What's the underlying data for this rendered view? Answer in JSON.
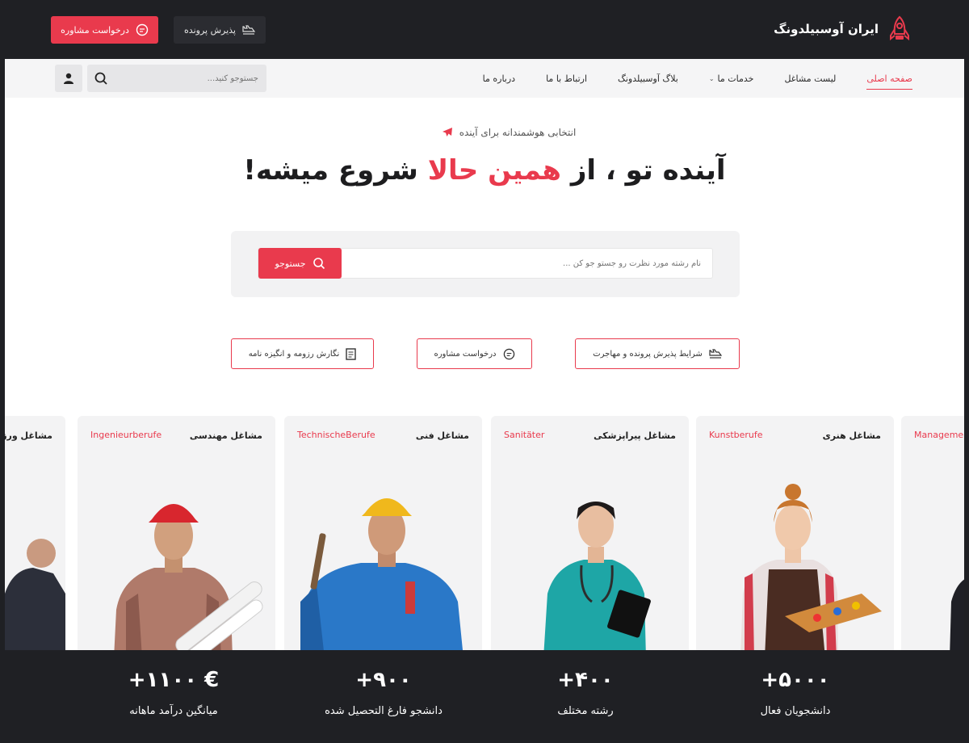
{
  "brand": {
    "name": "ایران آوسبیلدونگ"
  },
  "topbar": {
    "consult_label": "درخواست مشاوره",
    "admission_label": "پذیرش پرونده"
  },
  "nav": {
    "items": [
      {
        "label": "صفحه اصلی"
      },
      {
        "label": "لیست مشاغل"
      },
      {
        "label": "خدمات ما"
      },
      {
        "label": "بلاگ آوسبیلدونگ"
      },
      {
        "label": "ارتباط با ما"
      },
      {
        "label": "درباره ما"
      }
    ],
    "search_placeholder": "جستوجو کنید..."
  },
  "hero": {
    "tagline": "انتخابی هوشمندانه برای آینده",
    "headline_part1": "آینده تو ، از",
    "headline_highlight": "همین حالا",
    "headline_part2": "شروع میشه!",
    "search_placeholder": "نام رشته مورد نظرت رو جستو جو کن ...",
    "search_button": "جستوجو"
  },
  "quick_links": [
    {
      "label": "شرایط پذیرش پرونده و مهاجرت"
    },
    {
      "label": "درخواست مشاوره"
    },
    {
      "label": "نگارش رزومه و انگیزه نامه"
    }
  ],
  "cards": [
    {
      "fa": "مشاغل ورزشی",
      "de": ""
    },
    {
      "fa": "مشاغل مهندسی",
      "de": "Ingenieurberufe"
    },
    {
      "fa": "مشاغل فنی",
      "de": "TechnischeBerufe"
    },
    {
      "fa": "مشاغل پیراپزشکی",
      "de": "Sanitäter"
    },
    {
      "fa": "مشاغل هنری",
      "de": "Kunstberufe"
    },
    {
      "fa": "",
      "de": "Manageme"
    }
  ],
  "stats": [
    {
      "value": "+۱۱۰۰ €",
      "label": "میانگین درآمد ماهانه"
    },
    {
      "value": "+۹۰۰",
      "label": "دانشجو فارغ التحصیل شده"
    },
    {
      "value": "+۴۰۰",
      "label": "رشته مختلف"
    },
    {
      "value": "+۵۰۰۰",
      "label": "دانشجویان فعال"
    }
  ],
  "colors": {
    "accent": "#e93a4d",
    "dark": "#1f2024"
  }
}
